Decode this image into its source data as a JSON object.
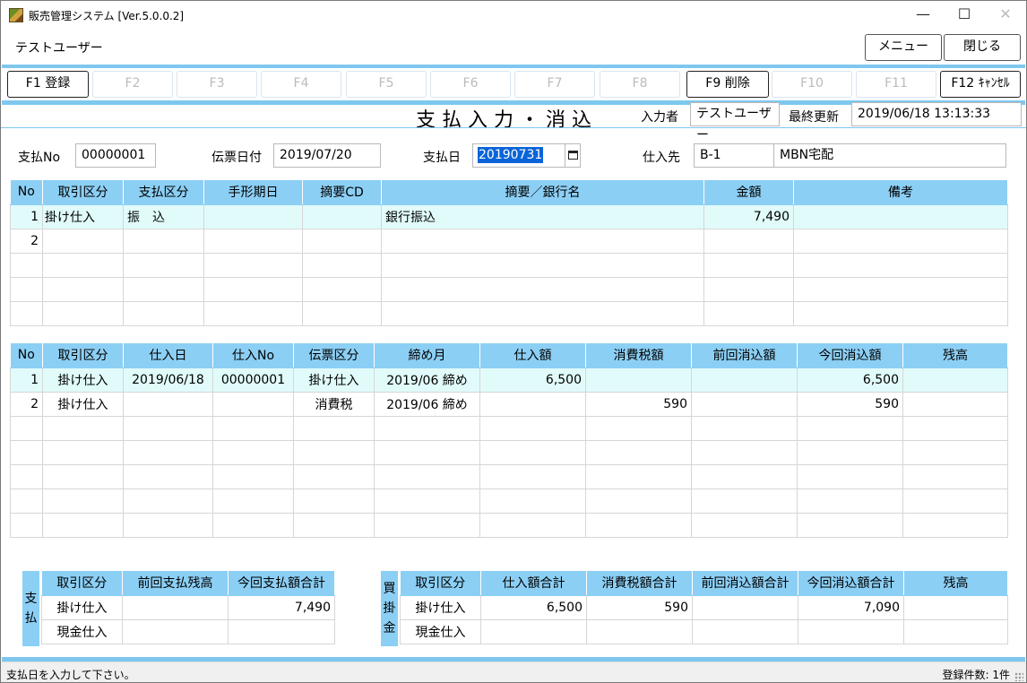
{
  "window": {
    "title": "販売管理システム [Ver.5.0.0.2]",
    "controls": {
      "minimize": "—",
      "maximize": "☐",
      "close": "✕"
    }
  },
  "header": {
    "user_label": "テストユーザー",
    "menu_button": "メニュー",
    "close_button": "閉じる"
  },
  "function_keys": [
    {
      "label": "F1 登録",
      "enabled": true
    },
    {
      "label": "F2",
      "enabled": false
    },
    {
      "label": "F3",
      "enabled": false
    },
    {
      "label": "F4",
      "enabled": false
    },
    {
      "label": "F5",
      "enabled": false
    },
    {
      "label": "F6",
      "enabled": false
    },
    {
      "label": "F7",
      "enabled": false
    },
    {
      "label": "F8",
      "enabled": false
    },
    {
      "label": "F9 削除",
      "enabled": true
    },
    {
      "label": "F10",
      "enabled": false
    },
    {
      "label": "F11",
      "enabled": false
    },
    {
      "label": "F12 ｷｬﾝｾﾙ",
      "enabled": true
    }
  ],
  "screen": {
    "title": "支払入力・消込",
    "entered_by_label": "入力者",
    "entered_by_value": "テストユーザー",
    "last_updated_label": "最終更新",
    "last_updated_value": "2019/06/18 13:13:33"
  },
  "form": {
    "payment_no_label": "支払No",
    "payment_no_value": "00000001",
    "slip_date_label": "伝票日付",
    "slip_date_value": "2019/07/20",
    "payment_date_label": "支払日",
    "payment_date_value": "20190731",
    "supplier_label": "仕入先",
    "supplier_code": "B-1",
    "supplier_name": "MBN宅配"
  },
  "payment_table": {
    "headers": [
      "No",
      "取引区分",
      "支払区分",
      "手形期日",
      "摘要CD",
      "摘要／銀行名",
      "金額",
      "備考"
    ],
    "rows": [
      [
        "1",
        "掛け仕入",
        "振　込",
        "",
        "",
        "銀行振込",
        "7,490",
        ""
      ],
      [
        "2",
        "",
        "",
        "",
        "",
        "",
        "",
        ""
      ],
      [
        "",
        "",
        "",
        "",
        "",
        "",
        "",
        ""
      ],
      [
        "",
        "",
        "",
        "",
        "",
        "",
        "",
        ""
      ],
      [
        "",
        "",
        "",
        "",
        "",
        "",
        "",
        ""
      ]
    ]
  },
  "purchase_table": {
    "headers": [
      "No",
      "取引区分",
      "仕入日",
      "仕入No",
      "伝票区分",
      "締め月",
      "仕入額",
      "消費税額",
      "前回消込額",
      "今回消込額",
      "残高"
    ],
    "rows": [
      [
        "1",
        "掛け仕入",
        "2019/06/18",
        "00000001",
        "掛け仕入",
        "2019/06 締め",
        "6,500",
        "",
        "",
        "6,500",
        ""
      ],
      [
        "2",
        "掛け仕入",
        "",
        "",
        "消費税",
        "2019/06 締め",
        "",
        "590",
        "",
        "590",
        ""
      ],
      [
        "",
        "",
        "",
        "",
        "",
        "",
        "",
        "",
        "",
        "",
        ""
      ],
      [
        "",
        "",
        "",
        "",
        "",
        "",
        "",
        "",
        "",
        "",
        ""
      ],
      [
        "",
        "",
        "",
        "",
        "",
        "",
        "",
        "",
        "",
        "",
        ""
      ],
      [
        "",
        "",
        "",
        "",
        "",
        "",
        "",
        "",
        "",
        "",
        ""
      ],
      [
        "",
        "",
        "",
        "",
        "",
        "",
        "",
        "",
        "",
        "",
        ""
      ]
    ]
  },
  "payment_summary": {
    "side_label": [
      "支",
      "払"
    ],
    "headers": [
      "取引区分",
      "前回支払残高",
      "今回支払額合計"
    ],
    "rows": [
      [
        "掛け仕入",
        "",
        "7,490"
      ],
      [
        "現金仕入",
        "",
        ""
      ]
    ]
  },
  "payable_summary": {
    "side_label": [
      "買",
      "掛",
      "金"
    ],
    "headers": [
      "取引区分",
      "仕入額合計",
      "消費税額合計",
      "前回消込額合計",
      "今回消込額合計",
      "残高"
    ],
    "rows": [
      [
        "掛け仕入",
        "6,500",
        "590",
        "",
        "7,090",
        ""
      ],
      [
        "現金仕入",
        "",
        "",
        "",
        "",
        ""
      ]
    ]
  },
  "status_bar": {
    "message": "支払日を入力して下さい。",
    "record_count": "登録件数: 1件"
  },
  "colors": {
    "accent": "#7ec8ef",
    "header_fill": "#8ccff5",
    "selected_row": "#e1fbfb",
    "selection": "#0a64d8"
  }
}
